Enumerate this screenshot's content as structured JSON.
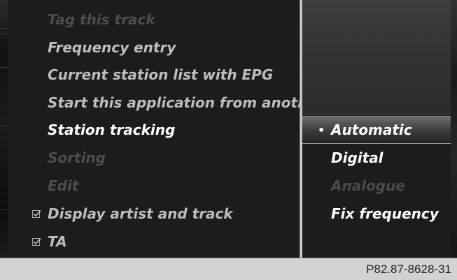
{
  "main_menu": {
    "items": [
      {
        "label": "Tag this track",
        "state": "disabled",
        "checked": false
      },
      {
        "label": "Frequency entry",
        "state": "normal",
        "checked": false
      },
      {
        "label": "Current station list with EPG",
        "state": "normal",
        "checked": false
      },
      {
        "label": "Start this application from anoth",
        "state": "normal",
        "checked": false
      },
      {
        "label": "Station tracking",
        "state": "active",
        "checked": false
      },
      {
        "label": "Sorting",
        "state": "disabled",
        "checked": false
      },
      {
        "label": "Edit",
        "state": "disabled",
        "checked": false
      },
      {
        "label": "Display artist and track",
        "state": "normal",
        "checked": true
      },
      {
        "label": "TA",
        "state": "normal",
        "checked": true
      }
    ]
  },
  "submenu": {
    "items": [
      {
        "label": "Automatic",
        "state": "selected",
        "bullet": "•"
      },
      {
        "label": "Digital",
        "state": "normal"
      },
      {
        "label": "Analogue",
        "state": "disabled"
      },
      {
        "label": "Fix frequency",
        "state": "normal"
      }
    ]
  },
  "icons": {
    "checkbox": "checkbox-checked-icon",
    "bullet": "bullet-icon"
  },
  "caption": "P82.87-8628-31",
  "colors": {
    "background": "#1b1b1b",
    "text": "#ffffff",
    "disabled_text": "#4d4d4d",
    "caption_bar": "#d2d2d2"
  }
}
